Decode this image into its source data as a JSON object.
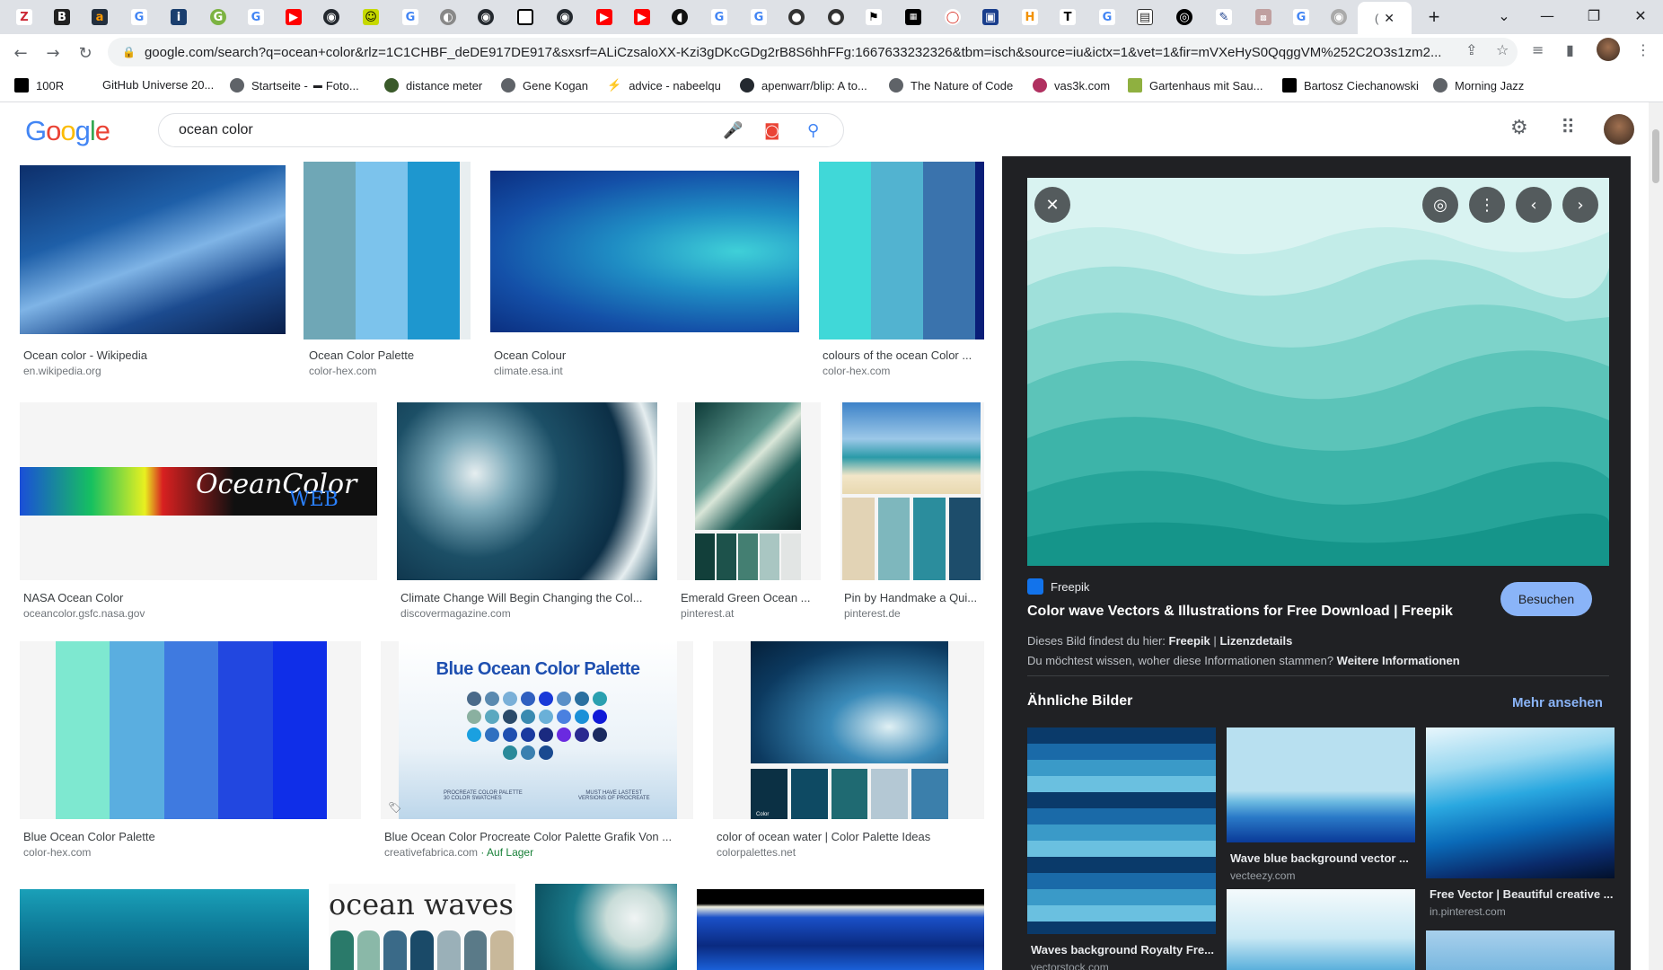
{
  "browser": {
    "active_tab_short": "(",
    "url": "google.com/search?q=ocean+color&rlz=1C1CHBF_deDE917DE917&sxsrf=ALiCzsaloXX-Kzi3gDKcGDg2rB8S6hhFFg:1667633232326&tbm=isch&source=iu&ictx=1&vet=1&fir=mVXeHyS0QqggVM%252C2O3s1zm2..."
  },
  "bookmarks": [
    {
      "label": "100R"
    },
    {
      "label": "GitHub Universe 20..."
    },
    {
      "label": "Startseite - "
    },
    {
      "label": "Foto..."
    },
    {
      "label": "distance meter"
    },
    {
      "label": "Gene Kogan"
    },
    {
      "label": "advice - nabeelqu"
    },
    {
      "label": "apenwarr/blip: A to..."
    },
    {
      "label": "The Nature of Code"
    },
    {
      "label": "vas3k.com"
    },
    {
      "label": "Gartenhaus mit Sau..."
    },
    {
      "label": "Bartosz Ciechanowski"
    },
    {
      "label": "Morning Jazz"
    }
  ],
  "search": {
    "query": "ocean color"
  },
  "results": [
    {
      "title": "Ocean color - Wikipedia",
      "source": "en.wikipedia.org"
    },
    {
      "title": "Ocean Color Palette",
      "source": "color-hex.com"
    },
    {
      "title": "Ocean Colour",
      "source": "climate.esa.int"
    },
    {
      "title": "colours of the ocean Color ...",
      "source": "color-hex.com"
    },
    {
      "title": "NASA Ocean Color",
      "source": "oceancolor.gsfc.nasa.gov"
    },
    {
      "title": "Climate Change Will Begin Changing the Col...",
      "source": "discovermagazine.com"
    },
    {
      "title": "Emerald Green Ocean ...",
      "source": "pinterest.at"
    },
    {
      "title": "Pin by Handmake a Qui...",
      "source": "pinterest.de"
    },
    {
      "title": "Blue Ocean Color Palette",
      "source": "color-hex.com"
    },
    {
      "title": "Blue Ocean Color Procreate Color Palette Grafik Von ...",
      "source": "creativefabrica.com",
      "stock": " · Auf Lager"
    },
    {
      "title": "color of ocean water | Color Palette Ideas",
      "source": "colorpalettes.net"
    }
  ],
  "image_text": {
    "oceancolor_logo": "OceanColor",
    "oceancolor_web": "WEB",
    "blue_palette_heading": "Blue Ocean Color Palette",
    "procreate_left": "PROCREATE COLOR PALETTE",
    "procreate_left2": "30 COLOR SWATCHES",
    "procreate_right": "MUST HAVE LASTEST",
    "procreate_right2": "VERSIONS OF PROCREATE",
    "ocean_waves": "ocean waves",
    "color_label": "Color"
  },
  "panel": {
    "source_name": "Freepik",
    "title": "Color wave Vectors & Illustrations for Free Download | Freepik",
    "visit_label": "Besuchen",
    "found_prefix": "Dieses Bild findest du hier:",
    "found_site": "Freepik",
    "found_sep": "|",
    "license": "Lizenzdetails",
    "info_q": "Du möchtest wissen, woher diese Informationen stammen?",
    "info_link": "Weitere Informationen",
    "similar_heading": "Ähnliche Bilder",
    "more_label": "Mehr ansehen",
    "similar": [
      {
        "title": "Waves background Royalty Fre...",
        "source": "vectorstock.com"
      },
      {
        "title": "Wave blue background vector ...",
        "source": "vecteezy.com"
      },
      {
        "title": "Free Vector | Beautiful creative ...",
        "source": "in.pinterest.com"
      }
    ]
  },
  "colors": {
    "accent": "#1a73e8",
    "panel_bg": "#202124",
    "visit_button": "#8ab4f8"
  }
}
